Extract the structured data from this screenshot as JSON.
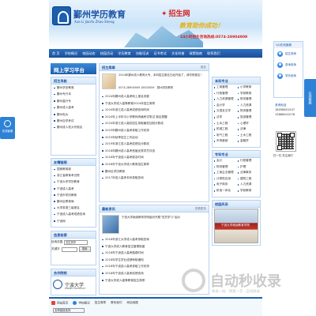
{
  "site": {
    "title": "鄞州学历教育",
    "title_en": "Xue Li JiaoYu Zhao Sheng",
    "brand": "招生网",
    "slogan": "教育助你成功！",
    "hotline": "24小时招生咨询热线:0574-28904909"
  },
  "nav": [
    "首 页",
    "学校概况",
    "校园动态",
    "校园活动",
    "学历教育",
    "技能培训",
    "证书考试",
    "文化科普",
    "政策指南",
    "联系我们"
  ],
  "left": {
    "banner": "网上学习平台",
    "menu_title": "招生导航",
    "menu": [
      "鄞州学历教育",
      "鄞州专升本",
      "鄞州高升专",
      "鄞州成人高考",
      "鄞州电大",
      "鄞州自学考试",
      "鄞州成人校大专报名"
    ],
    "links_title": "友情链接",
    "links": [
      "国家教育部",
      "浙江省教育考试院",
      "宁波大学学历教育",
      "宁波成人高考",
      "宁波市学历教育",
      "鄞州区教育局",
      "大学英语三级报名",
      "宁波成人高考成绩查询",
      "宁波网"
    ],
    "search_title": "信息检索",
    "search": {
      "label1": "检索范围",
      "scope": "招生简章",
      "label2": "关键字",
      "button": "搜索"
    },
    "school_title": "合作院校",
    "school_name": "宁波大学",
    "school_en": "NINGBO UNIVERSITY"
  },
  "middle": {
    "notice_title": "招生简章",
    "notice_more": "更多",
    "notice_text": "2024年鄞州成人教育大专、本科招生报名已经开始了，请尽快报名！",
    "notice_tel": "0574-28904909 28535059　鄞州学历教育",
    "news": [
      "2024年鄞州成人高考网上报名流程",
      "宁波大学成人高等教育2024年招生简章",
      "2024年浙江成人高考成绩查询时间",
      "2024年上半年中小学教师资格考试笔试 报名提醒",
      "2024年浙江成人高校招生录取最低控制分数线",
      "2023年鄞州成人高考录取工作安排",
      "2019年秋季招生工作启动",
      "2019年浙江成人高考成绩及分数线",
      "2018年鄞州成人高考首届优秀学员评选",
      "2018年宁波成人高考报名时间",
      "2018年宁波大学成人教育招生简章",
      "鄞州区学历教育",
      "2017年成人高考本科录取查询"
    ],
    "news2_title": "最新资讯",
    "news2_more": "查看更多",
    "news2": [
      "宁波大学继续教育学院组织开展“党员学习”活动",
      "2018年浙江大学成人高考录取查询",
      "宁波大学成人教育招生管理制度",
      "2018年宁波成人高考缴费时间",
      "2018年学生学业成绩审核通知",
      "2018年宁波成人高考录取工作安排",
      "2018年宁波成人高考成绩查询",
      "宁波大学成人高等教育招生简章"
    ]
  },
  "right": {
    "col1_title": "本科专业",
    "col1": [
      "工商管理",
      "行政管理",
      "人力资源管理",
      "会计学",
      "汉语言文学",
      "法学",
      "土木工程",
      "机械工程",
      "电气工程",
      "市场营销",
      "英语",
      "国际贸易",
      "护理学",
      "计算机"
    ],
    "col2": [
      "小学教育",
      "学前教育",
      "财务管理",
      "人力资源",
      "物流管理",
      "旅游管理",
      "心理学",
      "法律",
      "土木工程",
      "金融学",
      "会计",
      "电子商务",
      "市场营销",
      "建筑"
    ],
    "col3_title": "专科专业",
    "col3": [
      "会计",
      "物流管理",
      "工商企业管理",
      "计算机应用",
      "电子商务",
      "机电一体化",
      "数控技术",
      "电气自动化"
    ],
    "col4": [
      "行政管理",
      "护理",
      "法律事务",
      "建筑工程",
      "人力资源",
      "学前教育",
      "小学教育",
      "工程造价"
    ],
    "photo_title": "校园风采",
    "photo_caption": "宁波大学继续教育学院"
  },
  "qq": {
    "title": "QQ在线客服",
    "agents": [
      "招生老师",
      "咨询老师",
      "学历老师"
    ],
    "side_tab": "在线客服",
    "contact_label": "咨询电话",
    "tel1": "18058601507",
    "tel2": "15868441078",
    "qr_label": "扫一扫 关注我们"
  },
  "float_left": {
    "label": "在线客服"
  },
  "footer": {
    "links": [
      "网站首页",
      "学校概况",
      "招生简章",
      "联系我们",
      "网站地图"
    ],
    "select_label": "友情链接选择"
  },
  "watermark": {
    "text": "自动秒收录",
    "sub": "收录一站 · 快速一次 · 自动收录"
  }
}
